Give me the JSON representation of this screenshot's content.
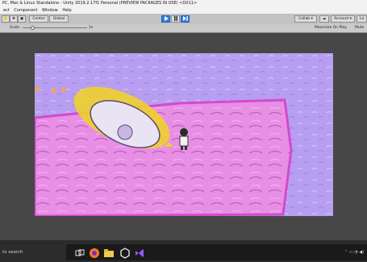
{
  "window": {
    "title": "PC, Mac & Linux Standalone - Unity 2019.2.17f1 Personal (PREVIEW PACKAGES IN USE) <DX11>"
  },
  "menu": [
    "ect",
    "Component",
    "Window",
    "Help"
  ],
  "toolbar": {
    "center_label": "Center",
    "global_label": "Global",
    "collab_label": "Collab ▾",
    "account_label": "Account ▾",
    "layers_label": "La"
  },
  "gamebar": {
    "scale_label": "Scale",
    "scale_value": "1x",
    "maximize_label": "Maximize On Play",
    "mute_label": "Mute A"
  },
  "taskbar": {
    "search_placeholder": "to search",
    "apps": [
      "task-view",
      "firefox",
      "file-explorer",
      "unity",
      "visual-studio"
    ]
  },
  "colors": {
    "editor_bg": "#474747",
    "sky": "#b79ef0",
    "ground": "#e78fe4",
    "ground_edge": "#d24ad0",
    "ship": "#f0d02c",
    "accent": "#2f7de1"
  }
}
